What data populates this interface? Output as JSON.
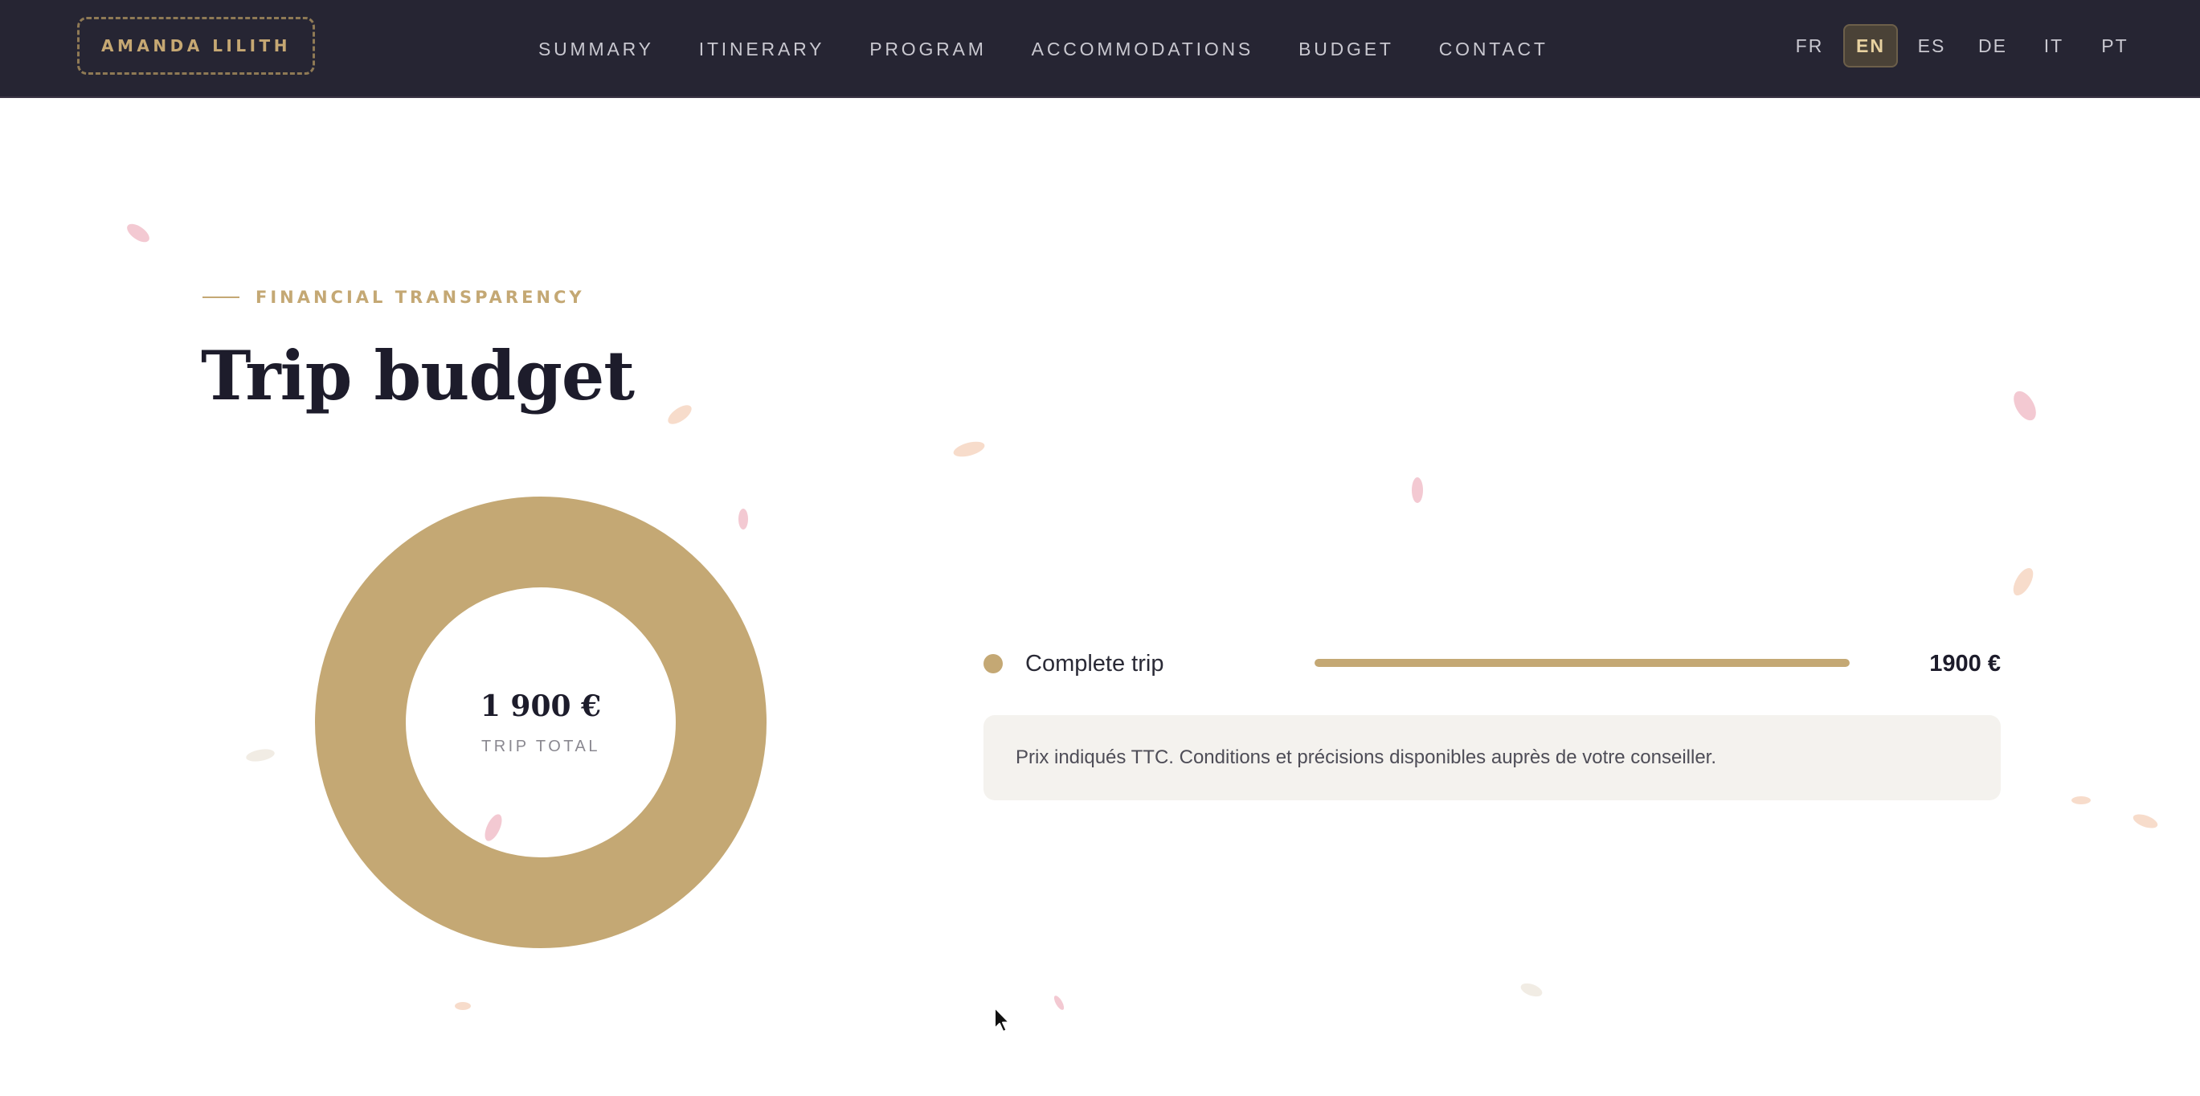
{
  "header": {
    "brand": "AMANDA LILITH",
    "nav": [
      "SUMMARY",
      "ITINERARY",
      "PROGRAM",
      "ACCOMMODATIONS",
      "BUDGET",
      "CONTACT"
    ],
    "languages": [
      "FR",
      "EN",
      "ES",
      "DE",
      "IT",
      "PT"
    ],
    "active_language": "EN"
  },
  "section": {
    "eyebrow": "FINANCIAL TRANSPARENCY",
    "title": "Trip budget"
  },
  "donut": {
    "total_label": "1 900 €",
    "caption": "TRIP TOTAL"
  },
  "breakdown": [
    {
      "label": "Complete trip",
      "amount": "1900 €",
      "share": 1.0
    }
  ],
  "note": "Prix indiqués TTC. Conditions et précisions disponibles auprès de votre conseiller.",
  "colors": {
    "accent": "#c4a874",
    "header_bg": "#262533",
    "title": "#1d1c2b",
    "note_bg": "#f4f2ee",
    "petal_pink": "#f3c9d2",
    "petal_peach": "#f7dccb"
  },
  "chart_data": {
    "type": "pie",
    "categories": [
      "Complete trip"
    ],
    "values": [
      1900
    ],
    "title": ""
  }
}
